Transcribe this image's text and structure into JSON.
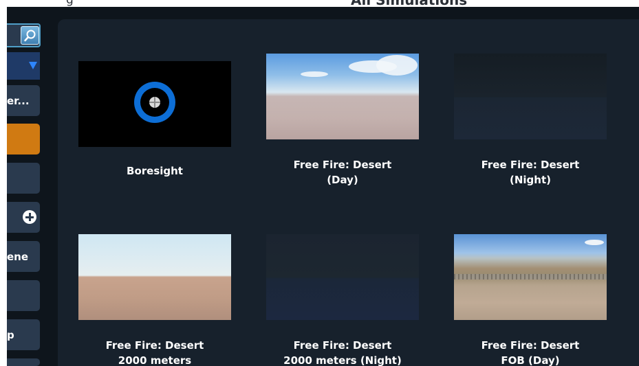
{
  "header": {
    "left_fragment": "g",
    "title_fragment": "All Simulations"
  },
  "sidebar": {
    "search": {
      "icon": "magnifier-icon"
    },
    "dropdown": {
      "icon": "caret-down-icon"
    },
    "buttons": [
      {
        "label": "er..."
      },
      {
        "label": ""
      },
      {
        "label": ""
      },
      {
        "label": ""
      },
      {
        "label": "ene"
      },
      {
        "label": ""
      },
      {
        "label": "p"
      }
    ]
  },
  "tiles": [
    {
      "title": "Boresight",
      "subtitle": ""
    },
    {
      "title": "Free Fire: Desert",
      "subtitle": "(Day)"
    },
    {
      "title": "Free Fire: Desert",
      "subtitle": "(Night)"
    },
    {
      "title": "Free Fire: Desert",
      "subtitle": "2000 meters"
    },
    {
      "title": "Free Fire: Desert",
      "subtitle": "2000 meters (Night)"
    },
    {
      "title": "Free Fire: Desert",
      "subtitle": "FOB (Day)"
    }
  ],
  "colors": {
    "background": "#0e151c",
    "panel": "#17212c",
    "button": "#2a3a4e",
    "accent_orange": "#d07a12",
    "accent_blue": "#2e86ff"
  }
}
